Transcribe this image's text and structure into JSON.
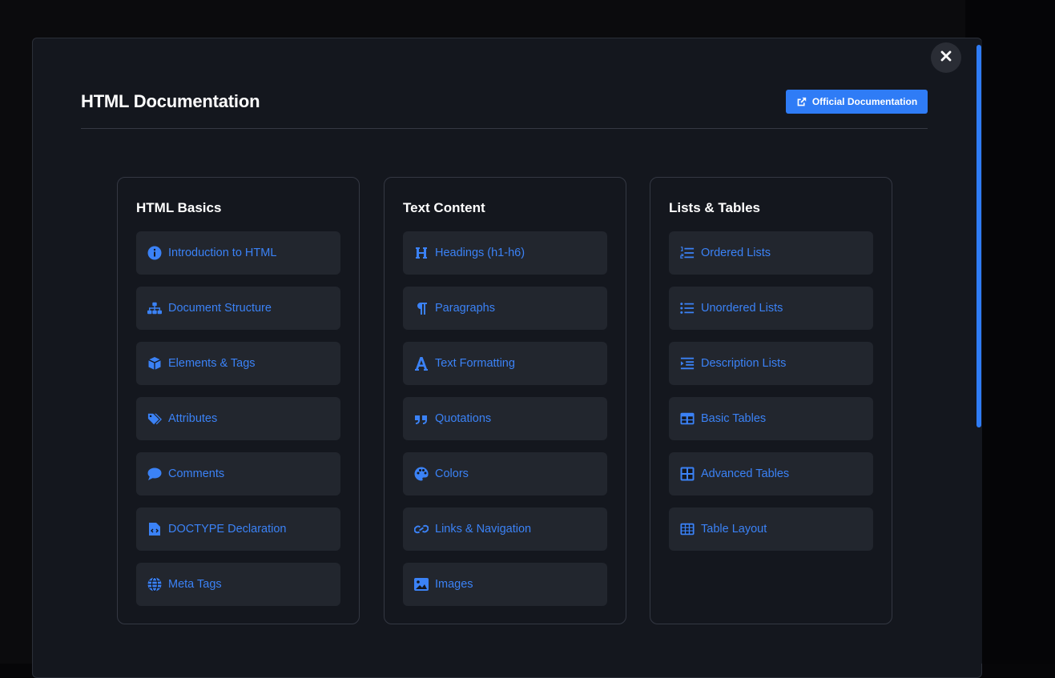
{
  "modal": {
    "title": "HTML Documentation",
    "official_button_label": "Official Documentation"
  },
  "colors": {
    "accent": "#2f7cf6",
    "link": "#3b82f6",
    "modal_bg": "#14171e",
    "item_bg": "#22262e"
  },
  "categories": [
    {
      "title": "HTML Basics",
      "items": [
        {
          "label": "Introduction to HTML",
          "icon": "info-circle-icon"
        },
        {
          "label": "Document Structure",
          "icon": "sitemap-icon"
        },
        {
          "label": "Elements & Tags",
          "icon": "cube-icon"
        },
        {
          "label": "Attributes",
          "icon": "tags-icon"
        },
        {
          "label": "Comments",
          "icon": "comment-icon"
        },
        {
          "label": "DOCTYPE Declaration",
          "icon": "file-code-icon"
        },
        {
          "label": "Meta Tags",
          "icon": "globe-icon"
        }
      ]
    },
    {
      "title": "Text Content",
      "items": [
        {
          "label": "Headings (h1-h6)",
          "icon": "heading-icon"
        },
        {
          "label": "Paragraphs",
          "icon": "paragraph-icon"
        },
        {
          "label": "Text Formatting",
          "icon": "font-icon"
        },
        {
          "label": "Quotations",
          "icon": "quote-icon"
        },
        {
          "label": "Colors",
          "icon": "palette-icon"
        },
        {
          "label": "Links & Navigation",
          "icon": "link-icon"
        },
        {
          "label": "Images",
          "icon": "image-icon"
        }
      ]
    },
    {
      "title": "Lists & Tables",
      "items": [
        {
          "label": "Ordered Lists",
          "icon": "list-ol-icon"
        },
        {
          "label": "Unordered Lists",
          "icon": "list-ul-icon"
        },
        {
          "label": "Description Lists",
          "icon": "indent-icon"
        },
        {
          "label": "Basic Tables",
          "icon": "table-icon"
        },
        {
          "label": "Advanced Tables",
          "icon": "table-cells-large-icon"
        },
        {
          "label": "Table Layout",
          "icon": "table-cells-icon"
        }
      ]
    }
  ]
}
